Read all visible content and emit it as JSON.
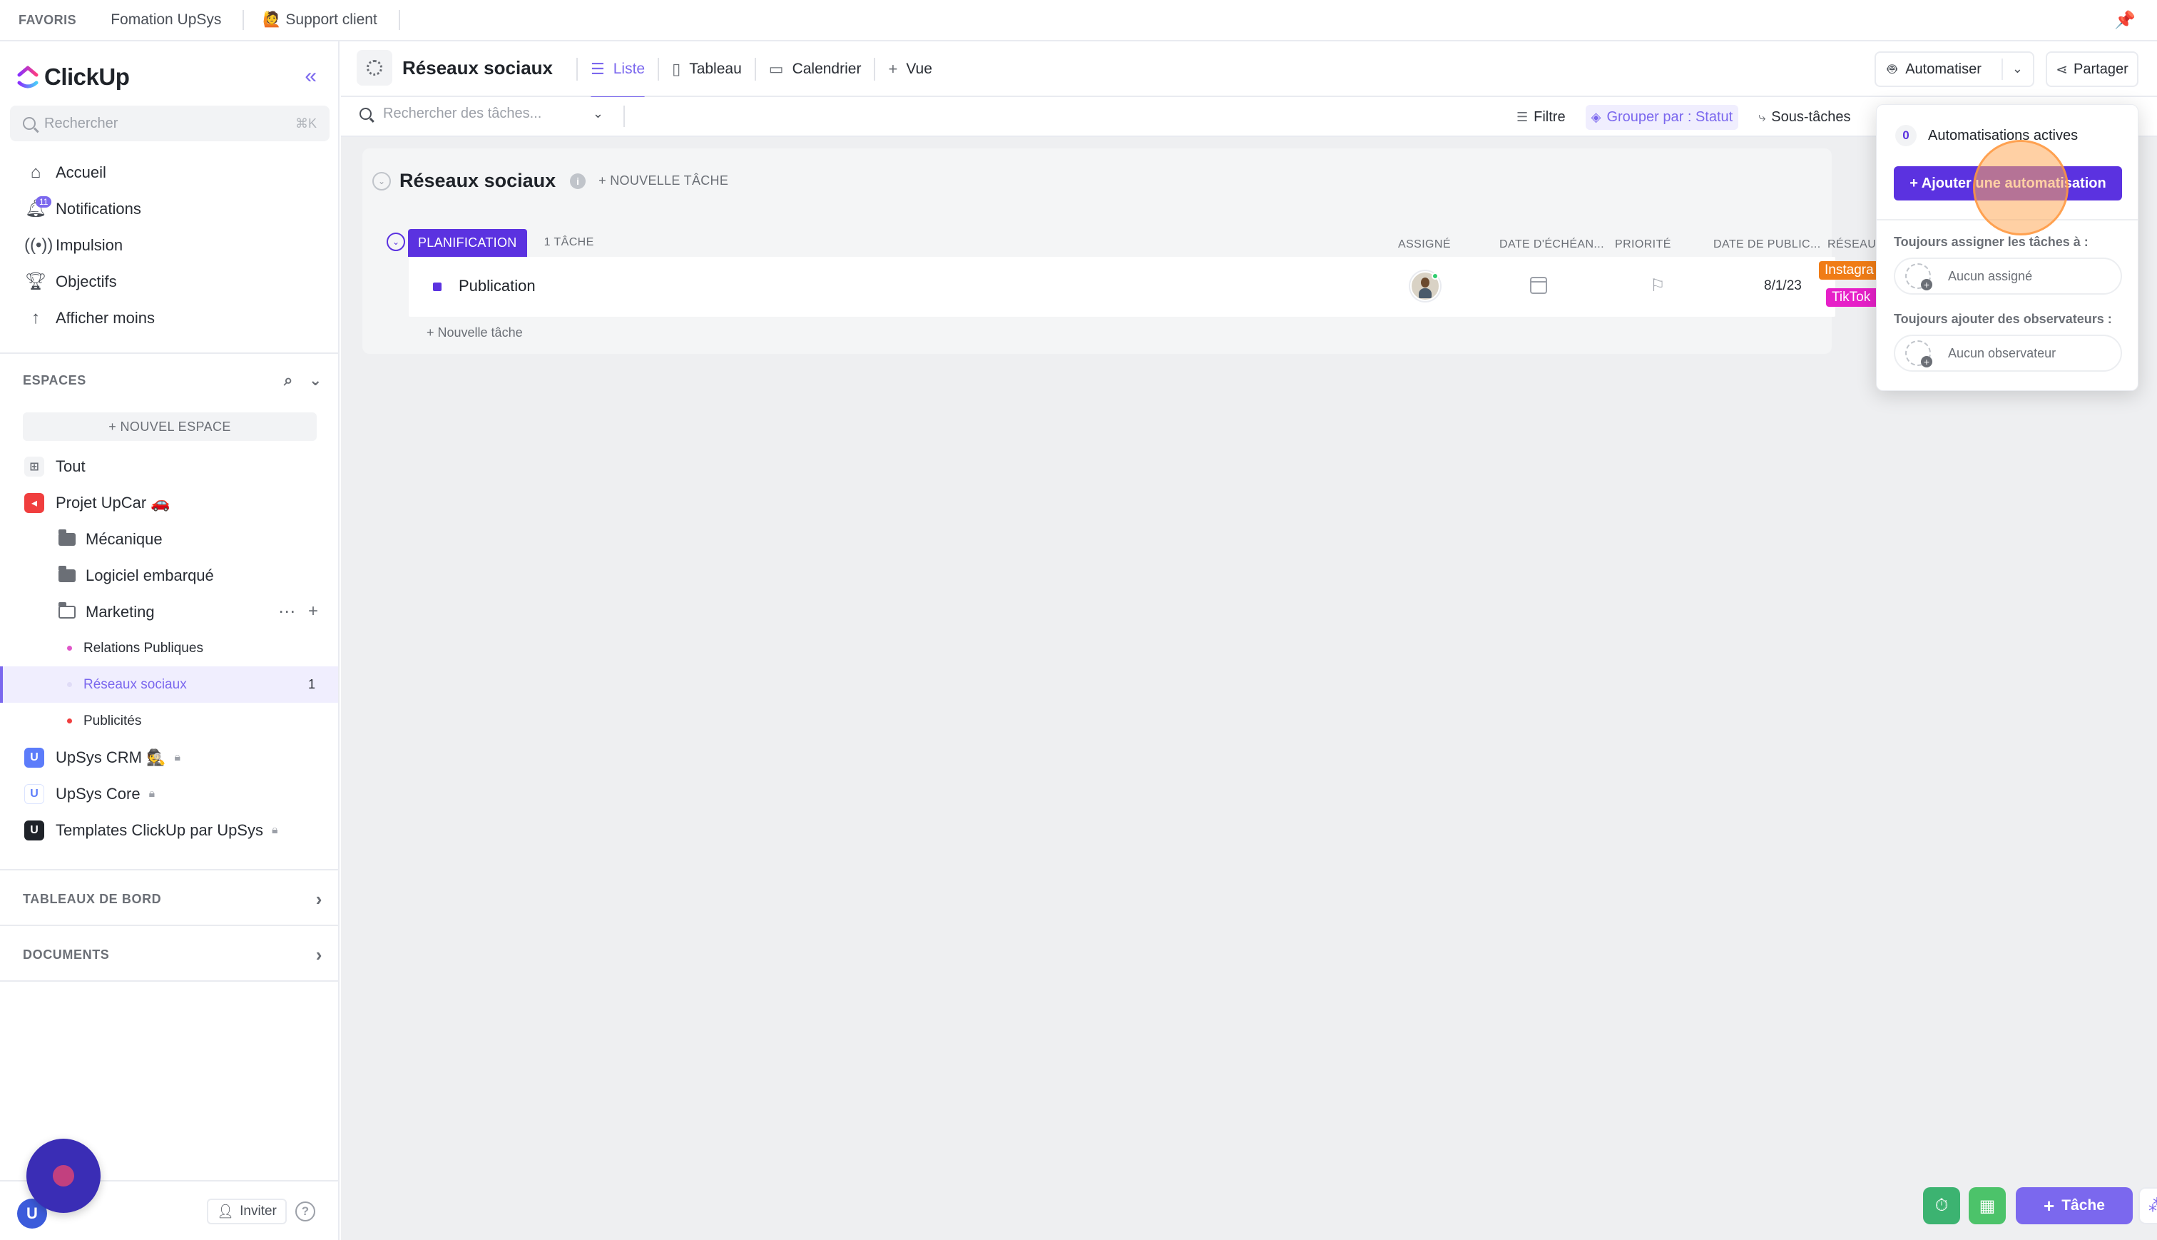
{
  "favorites": {
    "title": "FAVORIS",
    "items": [
      "Fomation UpSys",
      "🙋 Support client"
    ]
  },
  "sidebar": {
    "brand": "ClickUp",
    "search": {
      "placeholder": "Rechercher",
      "shortcut": "⌘K"
    },
    "nav": [
      {
        "label": "Accueil",
        "icon": "home-icon"
      },
      {
        "label": "Notifications",
        "icon": "bell-icon",
        "badge": "11"
      },
      {
        "label": "Impulsion",
        "icon": "pulse-icon"
      },
      {
        "label": "Objectifs",
        "icon": "trophy-icon"
      },
      {
        "label": "Afficher moins",
        "icon": "arrow-up-icon"
      }
    ],
    "spaces_title": "ESPACES",
    "new_space": "+ NOUVEL ESPACE",
    "spaces": {
      "all": "Tout",
      "project": "Projet UpCar 🚗",
      "folders": [
        "Mécanique",
        "Logiciel embarqué",
        "Marketing"
      ],
      "lists": [
        {
          "label": "Relations Publiques",
          "color": "#e056c9"
        },
        {
          "label": "Réseaux sociaux",
          "count": "1"
        },
        {
          "label": "Publicités",
          "color": "#f03e3e"
        }
      ],
      "others": [
        "UpSys CRM 🕵️",
        "UpSys Core",
        "Templates ClickUp par UpSys"
      ]
    },
    "dashboards_title": "TABLEAUX DE BORD",
    "docs_title": "DOCUMENTS",
    "invite_label": "Inviter",
    "avatar_letter": "U"
  },
  "header": {
    "title": "Réseaux sociaux",
    "tabs": [
      "Liste",
      "Tableau",
      "Calendrier",
      "Vue"
    ],
    "automate_label": "Automatiser",
    "share_label": "Partager"
  },
  "toolbar": {
    "search_placeholder": "Rechercher des tâches...",
    "filter": "Filtre",
    "group_by": "Grouper par : Statut",
    "subtasks": "Sous-tâches"
  },
  "list": {
    "title": "Réseaux sociaux",
    "new_task": "+ NOUVELLE TÂCHE",
    "group": {
      "status": "PLANIFICATION",
      "count": "1 TÂCHE",
      "columns": [
        "ASSIGNÉ",
        "DATE D'ÉCHÉAN...",
        "PRIORITÉ",
        "DATE DE PUBLIC...",
        "RÉSEAU"
      ]
    },
    "tasks": [
      {
        "name": "Publication",
        "pub_date": "8/1/23",
        "tags": [
          "Instagra",
          "TikTok"
        ]
      }
    ],
    "add_task": "+ Nouvelle tâche"
  },
  "automations": {
    "active_count": "0",
    "active_label": "Automatisations actives",
    "add_button": "+ Ajouter une automatisation",
    "assign_label": "Toujours assigner les tâches à :",
    "assign_value": "Aucun assigné",
    "watchers_label": "Toujours ajouter des observateurs :",
    "watchers_value": "Aucun observateur"
  },
  "fab": {
    "task_label": "Tâche"
  },
  "colors": {
    "accent": "#7b68ee",
    "status": "#5b32e0",
    "instagram": "#f07c16",
    "tiktok": "#e620c8"
  }
}
